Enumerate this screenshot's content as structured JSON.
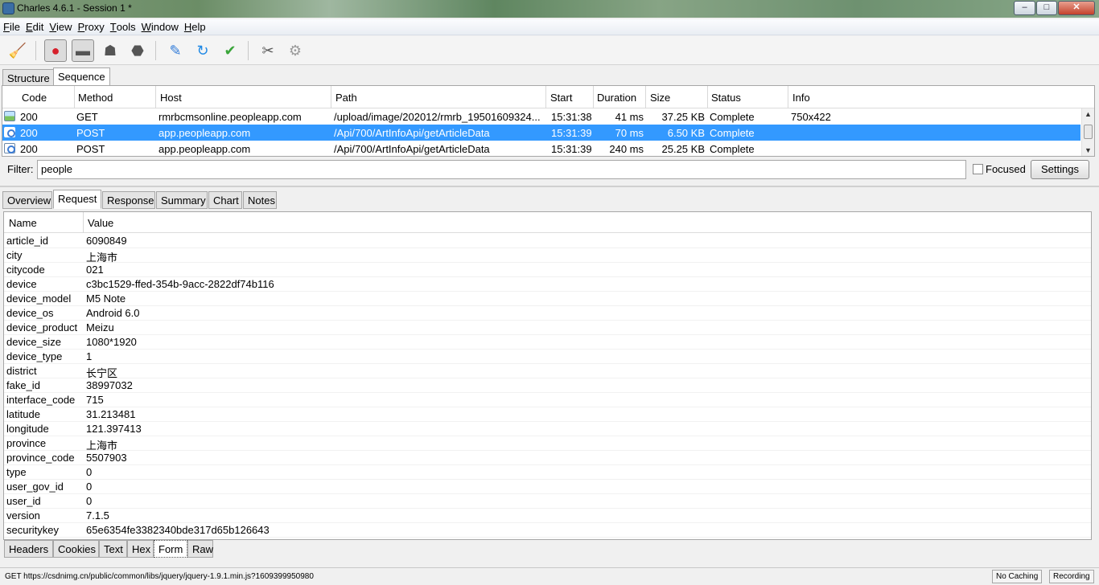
{
  "window": {
    "title": "Charles 4.6.1 - Session 1 *",
    "controls": [
      "minimize",
      "maximize",
      "close"
    ]
  },
  "menu": {
    "items": [
      {
        "label": "File",
        "mnemonic": "F",
        "rest": "ile"
      },
      {
        "label": "Edit",
        "mnemonic": "E",
        "rest": "dit"
      },
      {
        "label": "View",
        "mnemonic": "V",
        "rest": "iew"
      },
      {
        "label": "Proxy",
        "mnemonic": "P",
        "rest": "roxy"
      },
      {
        "label": "Tools",
        "mnemonic": "T",
        "rest": "ools"
      },
      {
        "label": "Window",
        "mnemonic": "W",
        "rest": "indow"
      },
      {
        "label": "Help",
        "mnemonic": "H",
        "rest": "elp"
      }
    ]
  },
  "toolbar": {
    "buttons": [
      {
        "name": "broom-icon",
        "glyph": "🧹",
        "color": "#d4a017"
      },
      {
        "name": "record-icon",
        "glyph": "●",
        "color": "#d6202b",
        "pressed": true
      },
      {
        "name": "throttle-icon",
        "glyph": "▬",
        "color": "#555555",
        "pressed": true
      },
      {
        "name": "turtle-icon",
        "glyph": "☗",
        "color": "#555555"
      },
      {
        "name": "stop-icon",
        "glyph": "⬣",
        "color": "#555555"
      },
      {
        "name": "pen-icon",
        "glyph": "✎",
        "color": "#2f7ad8"
      },
      {
        "name": "refresh-icon",
        "glyph": "↻",
        "color": "#1e88e5"
      },
      {
        "name": "check-icon",
        "glyph": "✔",
        "color": "#3aa53a"
      },
      {
        "name": "tools-icon",
        "glyph": "✂",
        "color": "#555555"
      },
      {
        "name": "gear-icon",
        "glyph": "⚙",
        "color": "#9a9a9a"
      }
    ]
  },
  "top_tabs": {
    "structure": "Structure",
    "sequence": "Sequence",
    "active": "Sequence"
  },
  "sequence": {
    "columns": {
      "code": "Code",
      "method": "Method",
      "host": "Host",
      "path": "Path",
      "start": "Start",
      "duration": "Duration",
      "size": "Size",
      "status": "Status",
      "info": "Info"
    },
    "rows": [
      {
        "icon": "image",
        "code": "200",
        "method": "GET",
        "host": "rmrbcmsonline.peopleapp.com",
        "path": "/upload/image/202012/rmrb_19501609324...",
        "start": "15:31:38",
        "duration": "41 ms",
        "size": "37.25 KB",
        "status": "Complete",
        "info": "750x422"
      },
      {
        "icon": "doc",
        "code": "200",
        "method": "POST",
        "host": "app.peopleapp.com",
        "path": "/Api/700/ArtInfoApi/getArticleData",
        "start": "15:31:39",
        "duration": "70 ms",
        "size": "6.50 KB",
        "status": "Complete",
        "info": ""
      },
      {
        "icon": "doc",
        "code": "200",
        "method": "POST",
        "host": "app.peopleapp.com",
        "path": "/Api/700/ArtInfoApi/getArticleData",
        "start": "15:31:39",
        "duration": "240 ms",
        "size": "25.25 KB",
        "status": "Complete",
        "info": ""
      }
    ],
    "selected_index": 1,
    "selection_color": "#3399ff"
  },
  "filter": {
    "label": "Filter:",
    "value": "people",
    "focused_label": "Focused",
    "focused_checked": false,
    "settings_label": "Settings"
  },
  "detail_tabs": {
    "items": [
      "Overview",
      "Request",
      "Response",
      "Summary",
      "Chart",
      "Notes"
    ],
    "active": "Request"
  },
  "form": {
    "columns": {
      "name": "Name",
      "value": "Value"
    },
    "rows": [
      {
        "name": "article_id",
        "value": "6090849"
      },
      {
        "name": "city",
        "value": "上海市"
      },
      {
        "name": "citycode",
        "value": "021"
      },
      {
        "name": "device",
        "value": "c3bc1529-ffed-354b-9acc-2822df74b116"
      },
      {
        "name": "device_model",
        "value": "M5 Note"
      },
      {
        "name": "device_os",
        "value": "Android 6.0"
      },
      {
        "name": "device_product",
        "value": "Meizu"
      },
      {
        "name": "device_size",
        "value": "1080*1920"
      },
      {
        "name": "device_type",
        "value": "1"
      },
      {
        "name": "district",
        "value": "长宁区"
      },
      {
        "name": "fake_id",
        "value": "38997032"
      },
      {
        "name": "interface_code",
        "value": "715"
      },
      {
        "name": "latitude",
        "value": "31.213481"
      },
      {
        "name": "longitude",
        "value": "121.397413"
      },
      {
        "name": "province",
        "value": "上海市"
      },
      {
        "name": "province_code",
        "value": "5507903"
      },
      {
        "name": "type",
        "value": "0"
      },
      {
        "name": "user_gov_id",
        "value": "0"
      },
      {
        "name": "user_id",
        "value": "0"
      },
      {
        "name": "version",
        "value": "7.1.5"
      },
      {
        "name": "securitykey",
        "value": "65e6354fe3382340bde317d65b126643"
      }
    ]
  },
  "bottom_tabs": {
    "items": [
      "Headers",
      "Cookies",
      "Text",
      "Hex",
      "Form",
      "Raw"
    ],
    "active": "Form"
  },
  "statusbar": {
    "url": "GET https://csdnimg.cn/public/common/libs/jquery/jquery-1.9.1.min.js?1609399950980",
    "no_caching": "No Caching",
    "recording": "Recording"
  }
}
